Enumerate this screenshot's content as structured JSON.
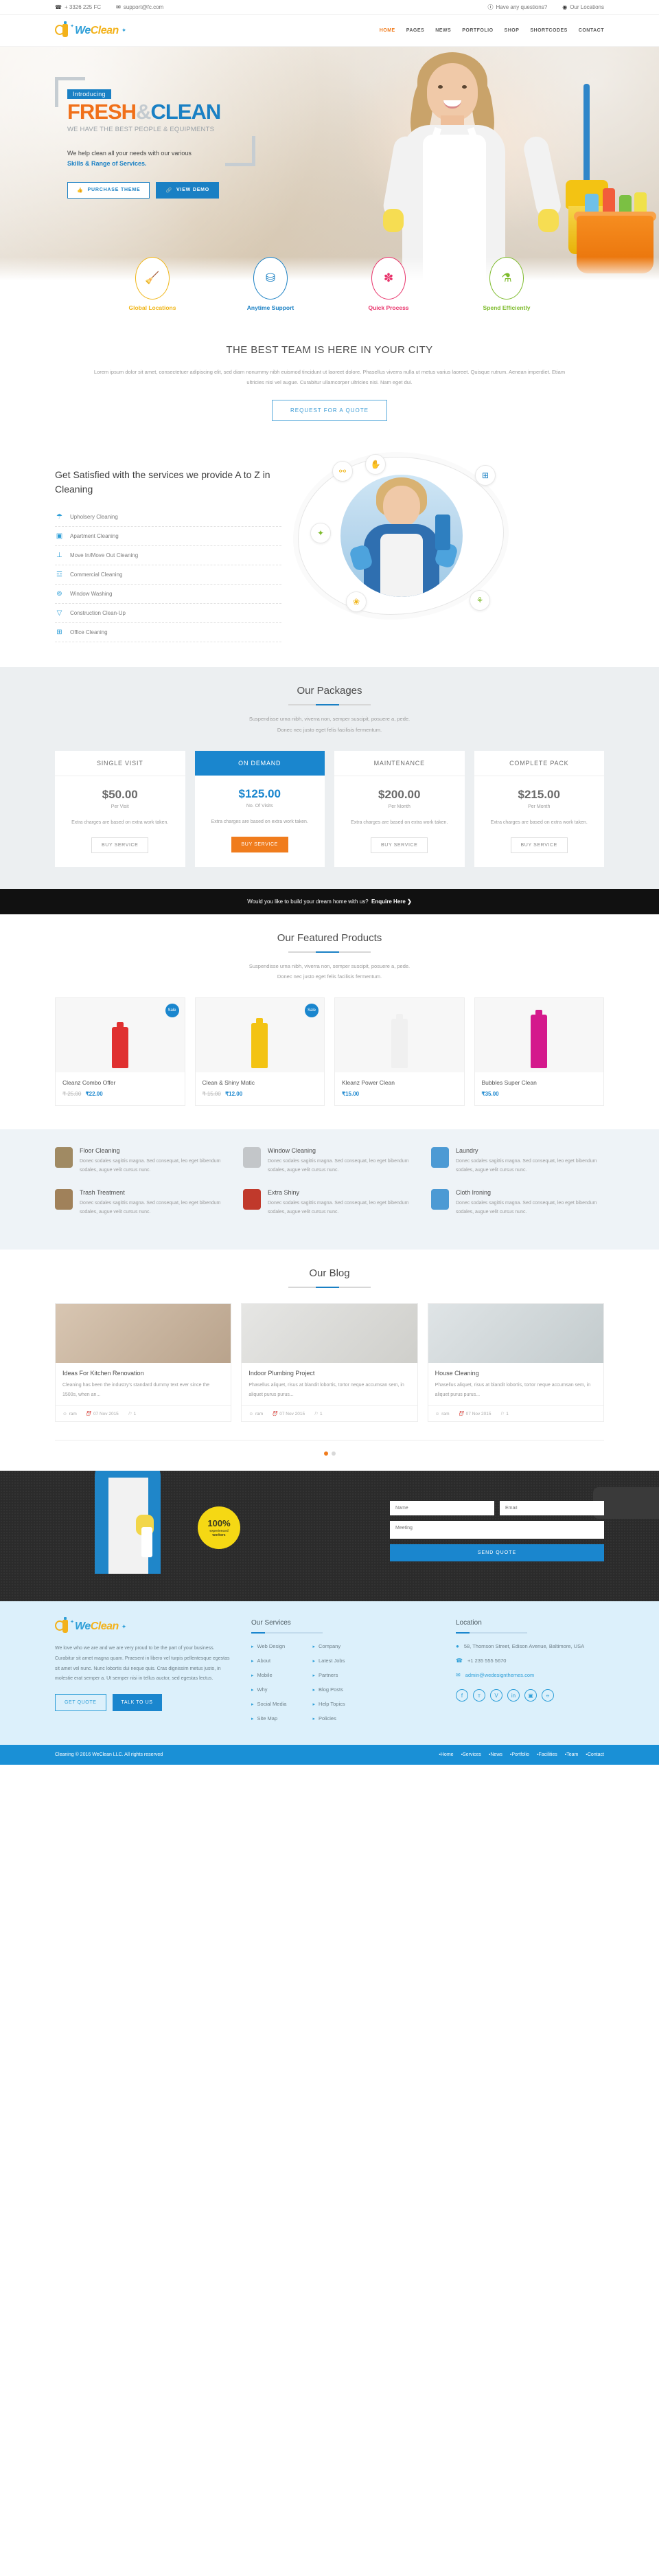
{
  "topbar": {
    "phone": "+ 3326 225 FC",
    "email": "support@fc.com",
    "questions": "Have any questions?",
    "locations": "Our Locations",
    "phone_icon": "phone-icon",
    "mail_icon": "mail-icon",
    "info_icon": "info-icon",
    "globe_icon": "globe-icon"
  },
  "brand": {
    "we": "We",
    "clean": "Clean"
  },
  "nav": [
    {
      "label": "HOME",
      "active": true
    },
    {
      "label": "PAGES",
      "active": false
    },
    {
      "label": "NEWS",
      "active": false
    },
    {
      "label": "PORTFOLIO",
      "active": false
    },
    {
      "label": "SHOP",
      "active": false
    },
    {
      "label": "SHORTCODES",
      "active": false
    },
    {
      "label": "CONTACT",
      "active": false
    }
  ],
  "hero": {
    "tag": "Introducing",
    "title_1": "FRESH",
    "title_amp": "&",
    "title_2": "CLEAN",
    "subtitle": "WE HAVE THE BEST PEOPLE & EQUIPMENTS",
    "paragraph": "We help clean all your needs with our various",
    "paragraph_bold": "Skills & Range of Services.",
    "btn_purchase": "PURCHASE THEME",
    "btn_demo": "VIEW DEMO",
    "btn_purchase_icon": "thumbs-up-icon",
    "btn_demo_icon": "link-icon"
  },
  "features": [
    {
      "label": "Global Locations",
      "icon": "broom-icon",
      "glyph": "🧹",
      "color": "#f0b517"
    },
    {
      "label": "Anytime Support",
      "icon": "washing-machine-icon",
      "glyph": "⛁",
      "color": "#1a80c4"
    },
    {
      "label": "Quick Process",
      "icon": "sponge-icon",
      "glyph": "✽",
      "color": "#e8326a"
    },
    {
      "label": "Spend Efficiently",
      "icon": "spray-bottle-icon",
      "glyph": "⚗",
      "color": "#7dbb2b"
    }
  ],
  "team": {
    "heading": "THE BEST TEAM IS HERE IN YOUR CITY",
    "paragraph": "Lorem ipsum dolor sit amet, consectetuer adipiscing elit, sed diam nonummy nibh euismod tincidunt ut laoreet dolore. Phasellus viverra nulla ut metus varius laoreet. Quisque rutrum. Aenean imperdiet. Etiam ultricies nisi vel augue. Curabitur ullamcorper ultricies nisi. Nam eget dui.",
    "button": "REQUEST FOR A QUOTE"
  },
  "services": {
    "heading": "Get Satisfied with the services we provide A to Z in Cleaning",
    "items": [
      {
        "label": "Upholsery Cleaning",
        "icon": "shirt-icon",
        "glyph": "☂"
      },
      {
        "label": "Apartment Cleaning",
        "icon": "apartment-icon",
        "glyph": "▣"
      },
      {
        "label": "Move In/Move Out Cleaning",
        "icon": "brush-icon",
        "glyph": "⊥"
      },
      {
        "label": "Commercial Cleaning",
        "icon": "trash-bin-icon",
        "glyph": "☲"
      },
      {
        "label": "Window Washing",
        "icon": "window-icon",
        "glyph": "⊚"
      },
      {
        "label": "Construction Clean-Up",
        "icon": "bucket-icon",
        "glyph": "▽"
      },
      {
        "label": "Office Cleaning",
        "icon": "office-icon",
        "glyph": "⊞"
      }
    ],
    "orbs": [
      {
        "icon": "bottle-icon",
        "glyph": "⚗"
      },
      {
        "icon": "glove-icon",
        "glyph": "✋"
      },
      {
        "icon": "window-icon",
        "glyph": "⊞"
      },
      {
        "icon": "broom-icon",
        "glyph": "✦"
      },
      {
        "icon": "sponge-icon",
        "glyph": "❀"
      },
      {
        "icon": "spray-icon",
        "glyph": "⚘"
      }
    ]
  },
  "packages": {
    "title": "Our Packages",
    "subtitle_1": "Suspendisse urna nibh, viverra non, semper suscipit, posuere a, pede.",
    "subtitle_2": "Donec nec justo eget felis facilisis fermentum.",
    "items": [
      {
        "name": "SINGLE VISIT",
        "price": "$50.00",
        "per": "Per Visit",
        "desc": "Extra charges are based on extra work taken.",
        "button": "BUY SERVICE",
        "featured": false
      },
      {
        "name": "ON DEMAND",
        "price": "$125.00",
        "per": "No. Of Visits",
        "desc": "Extra charges are based on extra work taken.",
        "button": "BUY SERVICE",
        "featured": true
      },
      {
        "name": "MAINTENANCE",
        "price": "$200.00",
        "per": "Per Month",
        "desc": "Extra charges are based on extra work taken.",
        "button": "BUY SERVICE",
        "featured": false
      },
      {
        "name": "COMPLETE PACK",
        "price": "$215.00",
        "per": "Per Month",
        "desc": "Extra charges are based on extra work taken.",
        "button": "BUY SERVICE",
        "featured": false
      }
    ]
  },
  "cta": {
    "text": "Would you like to build your dream home with us?",
    "link": "Enquire Here",
    "arrow": "❯"
  },
  "products": {
    "title": "Our Featured Products",
    "subtitle_1": "Suspendisse urna nibh, viverra non, semper suscipit, posuere a, pede.",
    "subtitle_2": "Donec nec justo eget felis facilisis fermentum.",
    "items": [
      {
        "name": "Cleanz Combo Offer",
        "old_price": "₹ 25.00",
        "price": "₹22.00",
        "badge": "Sale",
        "has_badge": true,
        "color": "#e03030"
      },
      {
        "name": "Clean & Shiny Matic",
        "old_price": "₹ 15.00",
        "price": "₹12.00",
        "badge": "Sale",
        "has_badge": true,
        "color": "#f3c313"
      },
      {
        "name": "Kleanz Power Clean",
        "old_price": "",
        "price": "₹15.00",
        "badge": "",
        "has_badge": false,
        "color": "#f0f0f0"
      },
      {
        "name": "Bubbles Super Clean",
        "old_price": "",
        "price": "₹35.00",
        "badge": "",
        "has_badge": false,
        "color": "#d4198c"
      }
    ]
  },
  "feature_grid": [
    {
      "title": "Floor Cleaning",
      "desc": "Donec sodales sagittis magna. Sed consequat, leo eget bibendum sodales, augue velit cursus nunc.",
      "icon": "trowel-icon",
      "color": "#a08a63"
    },
    {
      "title": "Window Cleaning",
      "desc": "Donec sodales sagittis magna. Sed consequat, leo eget bibendum sodales, augue velit cursus nunc.",
      "icon": "hammer-icon",
      "color": "#c3c6c9"
    },
    {
      "title": "Laundry",
      "desc": "Donec sodales sagittis magna. Sed consequat, leo eget bibendum sodales, augue velit cursus nunc.",
      "icon": "drill-icon",
      "color": "#4c9ad4"
    },
    {
      "title": "Trash Treatment",
      "desc": "Donec sodales sagittis magna. Sed consequat, leo eget bibendum sodales, augue velit cursus nunc.",
      "icon": "wrench-icon",
      "color": "#a0815a"
    },
    {
      "title": "Extra Shiny",
      "desc": "Donec sodales sagittis magna. Sed consequat, leo eget bibendum sodales, augue velit cursus nunc.",
      "icon": "spark-icon",
      "color": "#c0392b"
    },
    {
      "title": "Cloth Ironing",
      "desc": "Donec sodales sagittis magna. Sed consequat, leo eget bibendum sodales, augue velit cursus nunc.",
      "icon": "iron-icon",
      "color": "#4c9ad4"
    }
  ],
  "blog": {
    "title": "Our Blog",
    "posts": [
      {
        "title": "Ideas For Kitchen Renovation",
        "excerpt": "Cleaning has been the industry's standard dummy text ever since the 1500s, when an...",
        "author": "ram",
        "date": "07 Nov 2015",
        "comments": "1"
      },
      {
        "title": "Indoor Plumbing Project",
        "excerpt": "Phasellus aliquet, risus at blandit lobortis, tortor neque accumsan sem, in aliquet purus purus...",
        "author": "ram",
        "date": "07 Nov 2015",
        "comments": "1"
      },
      {
        "title": "House Cleaning",
        "excerpt": "Phasellus aliquet, risus at blandit lobortis, tortor neque accumsan sem, in aliquet purus purus...",
        "author": "ram",
        "date": "07 Nov 2015",
        "comments": "1"
      }
    ],
    "author_icon": "user-icon",
    "date_icon": "clock-icon",
    "comment_icon": "comment-icon"
  },
  "quote_banner": {
    "badge_num": "100%",
    "badge_t1": "experienced",
    "badge_t2": "workers",
    "name_placeholder": "Name",
    "email_placeholder": "Email",
    "subject_placeholder": "Meeting",
    "submit": "SEND QUOTE"
  },
  "footer": {
    "about": "We love who we are and we are very proud to be the part of your business. Curabitur sit amet magna quam. Praesent in libero vel turpis pellentesque egestas sit amet vel nunc. Nunc lobortis dui neque quis. Cras dignissim metus justo, in molestie erat semper a. Ut semper nisi in tellus auctor, sed egestas lectus.",
    "btn_quote": "GET QUOTE",
    "btn_talk": "TALK TO US",
    "services_title": "Our Services",
    "services_col1": [
      "Web Design",
      "About",
      "Mobile",
      "Why",
      "Social Media",
      "Site Map"
    ],
    "services_col2": [
      "Company",
      "Latest Jobs",
      "Partners",
      "Blog Posts",
      "Help Topics",
      "Policies"
    ],
    "location_title": "Location",
    "address": "58, Thomson Street, Edison Avenue, Baltimore, USA",
    "phone": "+1 235 555 5670",
    "email": "admin@wedesignthemes.com",
    "address_icon": "pin-icon",
    "phone_icon": "phone-icon",
    "email_icon": "mail-icon",
    "social": [
      {
        "icon": "facebook-icon",
        "glyph": "f"
      },
      {
        "icon": "twitter-icon",
        "glyph": "ᴛ"
      },
      {
        "icon": "vimeo-icon",
        "glyph": "V"
      },
      {
        "icon": "linkedin-icon",
        "glyph": "in"
      },
      {
        "icon": "flickr-icon",
        "glyph": "▣"
      },
      {
        "icon": "rss-icon",
        "glyph": "⦵"
      }
    ]
  },
  "copyright": {
    "text": "Cleaning © 2016 WeClean LLC. All rights reserved",
    "links": [
      "Home",
      "Services",
      "News",
      "Portfolio",
      "Facilities",
      "Team",
      "Contact"
    ]
  }
}
